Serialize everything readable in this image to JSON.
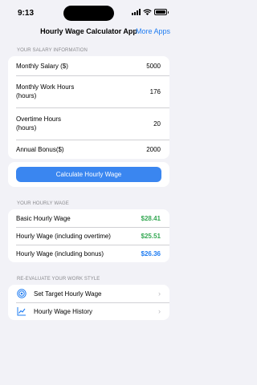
{
  "status": {
    "time": "9:13"
  },
  "nav": {
    "title": "Hourly Wage Calculator App",
    "more_apps": "More Apps"
  },
  "salary_section": {
    "header": "YOUR SALARY INFORMATION",
    "rows": [
      {
        "label": "Monthly Salary ($)",
        "value": "5000"
      },
      {
        "label": "Monthly Work Hours\n(hours)",
        "value": "176"
      },
      {
        "label": "Overtime Hours\n(hours)",
        "value": "20"
      },
      {
        "label": "Annual Bonus($)",
        "value": "2000"
      }
    ]
  },
  "calculate_button": "Calculate Hourly Wage",
  "wage_section": {
    "header": "YOUR HOURLY WAGE",
    "rows": [
      {
        "label": "Basic Hourly Wage",
        "value": "$28.41",
        "color": "#34a853"
      },
      {
        "label": "Hourly Wage (including overtime)",
        "value": "$25.51",
        "color": "#34a853"
      },
      {
        "label": "Hourly Wage (including bonus)",
        "value": "$26.36",
        "color": "#1e7cf2"
      }
    ]
  },
  "reevaluate_section": {
    "header": "RE-EVALUATE YOUR WORK STYLE",
    "items": [
      {
        "label": "Set Target Hourly Wage",
        "icon": "target-icon"
      },
      {
        "label": "Hourly Wage History",
        "icon": "chart-line-icon"
      }
    ]
  },
  "colors": {
    "accent": "#1e7cf2",
    "green": "#34a853",
    "background": "#f2f2f7"
  }
}
